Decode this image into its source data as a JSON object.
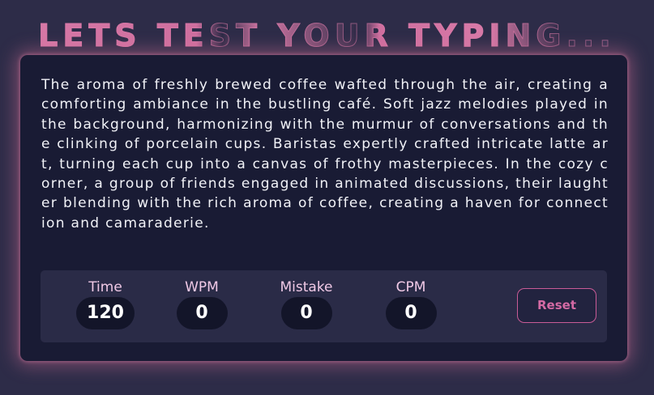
{
  "header": {
    "title": "LETS TEST YOUR TYPING..."
  },
  "paragraph": {
    "text": "The aroma of freshly brewed coffee wafted through the air, creating a comforting ambiance in the bustling café. Soft jazz melodies played in the background, harmonizing with the murmur of conversations and the clinking of porcelain cups. Baristas expertly crafted intricate latte art, turning each cup into a canvas of frothy masterpieces. In the cozy corner, a group of friends engaged in animated discussions, their laughter blending with the rich aroma of coffee, creating a haven for connection and camaraderie."
  },
  "stats": {
    "time": {
      "label": "Time",
      "value": "120"
    },
    "wpm": {
      "label": "WPM",
      "value": "0"
    },
    "mistake": {
      "label": "Mistake",
      "value": "0"
    },
    "cpm": {
      "label": "CPM",
      "value": "0"
    }
  },
  "controls": {
    "reset_label": "Reset"
  },
  "colors": {
    "background": "#2d2c48",
    "card": "#191b34",
    "accent": "#d46aa4",
    "title": "#d87aa8"
  }
}
